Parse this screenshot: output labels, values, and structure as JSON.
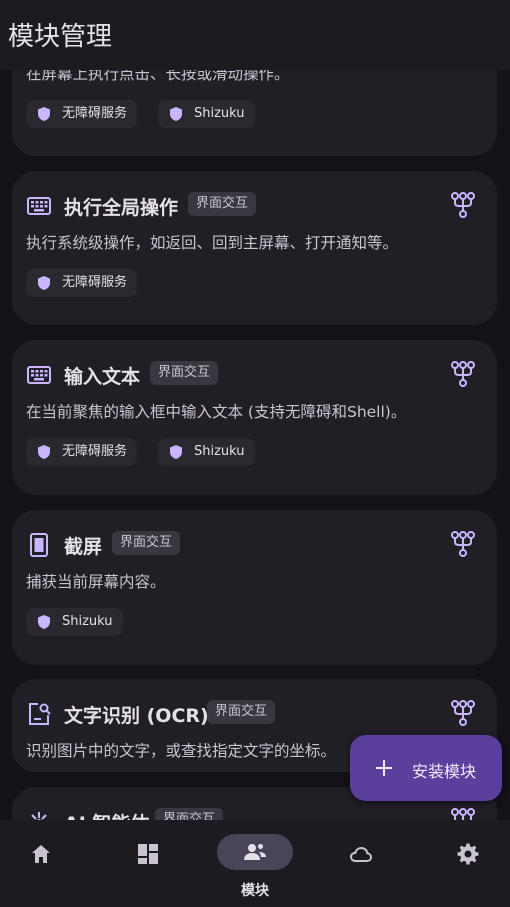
{
  "header": {
    "title": "模块管理"
  },
  "cards": [
    {
      "desc": "在屏幕上执行点击、长按或滑动操作。",
      "chips": [
        "无障碍服务",
        "Shizuku"
      ]
    },
    {
      "title": "执行全局操作",
      "tag": "界面交互",
      "icon": "keyboard-icon",
      "desc": "执行系统级操作，如返回、回到主屏幕、打开通知等。",
      "chips": [
        "无障碍服务"
      ]
    },
    {
      "title": "输入文本",
      "tag": "界面交互",
      "icon": "keyboard-icon",
      "desc": "在当前聚焦的输入框中输入文本 (支持无障碍和Shell)。",
      "chips": [
        "无障碍服务",
        "Shizuku"
      ]
    },
    {
      "title": "截屏",
      "tag": "界面交互",
      "icon": "screenshot-icon",
      "desc": "捕获当前屏幕内容。",
      "chips": [
        "Shizuku"
      ]
    },
    {
      "title": "文字识别 (OCR)",
      "tag": "界面交互",
      "icon": "text-search-icon",
      "desc": "识别图片中的文字，或查找指定文字的坐标。",
      "chips": []
    },
    {
      "title": "AI 智能体",
      "tag": "界面交互",
      "icon": "ai-agent-icon",
      "desc": "",
      "chips": []
    }
  ],
  "fab": {
    "label": "安装模块",
    "icon": "plus-icon"
  },
  "nav": {
    "items": [
      {
        "icon": "home-icon"
      },
      {
        "icon": "dashboard-icon"
      },
      {
        "icon": "modules-icon",
        "label": "模块",
        "selected": true
      },
      {
        "icon": "cloud-icon"
      },
      {
        "icon": "settings-icon"
      }
    ]
  },
  "colors": {
    "accent": "#C9B6FF",
    "background": "#141218",
    "card": "#211f26",
    "fab": "#5b3f9c"
  }
}
